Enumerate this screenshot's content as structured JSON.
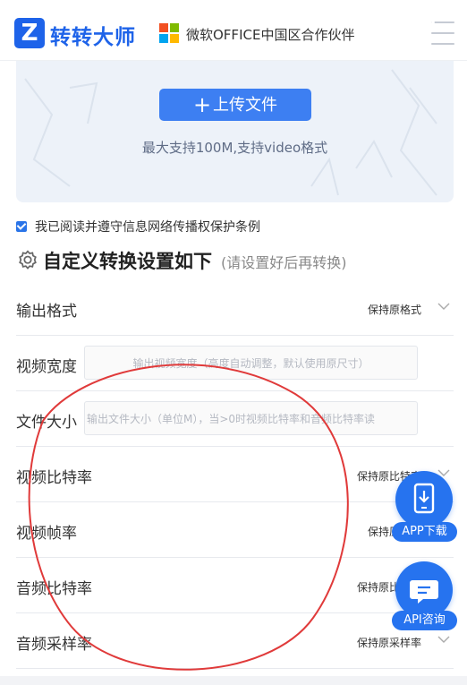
{
  "header": {
    "logo_letter": "Z",
    "brand": "转转大师",
    "partner_text": "微软OFFICE中国区合作伙伴"
  },
  "upload": {
    "button_label": "上传文件",
    "plus": "+",
    "hint": "最大支持100M,支持video格式"
  },
  "agreement": {
    "checked": true,
    "text": "我已阅读并遵守信息网络传播权保护条例"
  },
  "settings": {
    "title": "自定义转换设置如下",
    "subtitle": "(请设置好后再转换)"
  },
  "rows": [
    {
      "label": "输出格式",
      "type": "select",
      "value": "保持原格式"
    },
    {
      "label": "视频宽度",
      "type": "input",
      "placeholder": "输出视频宽度（高度自动调整，默认使用原尺寸）"
    },
    {
      "label": "文件大小",
      "type": "input",
      "placeholder": "输出文件大小（单位M），当>0时视频比特率和音频比特率读"
    },
    {
      "label": "视频比特率",
      "type": "select",
      "value": "保持原比特率"
    },
    {
      "label": "视频帧率",
      "type": "select",
      "value": "保持原帧率"
    },
    {
      "label": "音频比特率",
      "type": "select",
      "value": "保持原比特率"
    },
    {
      "label": "音频采样率",
      "type": "select",
      "value": "保持原采样率"
    }
  ],
  "floating": {
    "app_label": "APP下载",
    "api_label": "API咨询"
  },
  "colors": {
    "brand_blue": "#1e63e9",
    "accent_blue": "#2673ef",
    "annotation_red": "#e03a3a"
  }
}
